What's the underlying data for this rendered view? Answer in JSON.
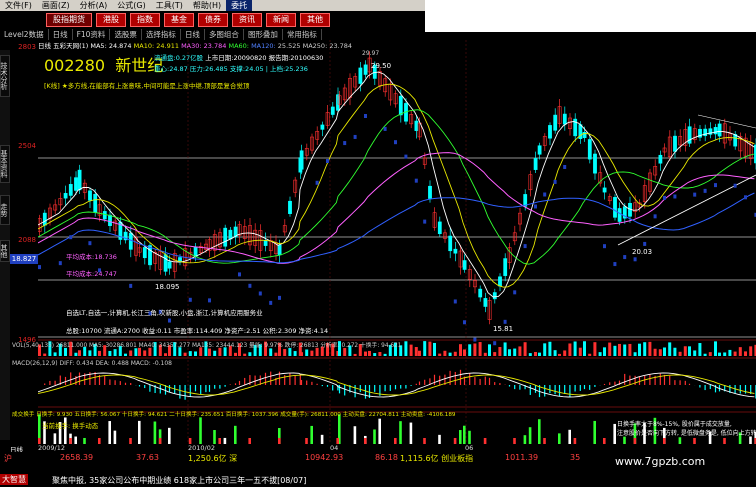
{
  "menu": {
    "items": [
      "文件(F)",
      "画面(Z)",
      "分析(A)",
      "公式(G)",
      "工具(T)",
      "帮助(H)",
      "委托"
    ]
  },
  "tabs": [
    "股指期货",
    "港股",
    "指数",
    "基金",
    "债券",
    "资讯",
    "新闻",
    "其他"
  ],
  "toolbar": {
    "items": [
      "Level2数据",
      "日线",
      "F10资料",
      "选股票",
      "选择指标",
      "日线",
      "多图组合",
      "图形叠加",
      "常用指标"
    ]
  },
  "main_header": {
    "period": "日线",
    "name": "五彩天网(1)",
    "ma5": "MA5: 24.874",
    "ma10": "MA10: 24.911",
    "ma30": "MA30: 23.784",
    "ma60": "MA60:",
    "ma120": "MA120:",
    "rest": "25.525  MA250: 23.784"
  },
  "stock": {
    "code": "002280",
    "name": "新世纪",
    "circulating": "流通盘:0.27亿股",
    "listing_date": "上市日期:20090820",
    "report_date": "报告期:20100630",
    "line2": "重心:24.87 压力:26.485 支撑:24.05 | 上档:25.236",
    "kline_msg": "[K线] ★多方线,在能部有上涨意味,中间可能是上涨中继,顶部是复合觉顶"
  },
  "price_axis": {
    "ticks": [
      "2803",
      "2504",
      "2088",
      "1496"
    ],
    "current_price": "18.827"
  },
  "annotations": {
    "high": "29.50",
    "high2": "29.97",
    "low1": "18.095",
    "low2": "15.81",
    "low3": "20.03",
    "cost1": "平均成本:18.736",
    "cost2": "平均成本:24.747",
    "concepts": "自选LT,自选一,计算机,长江三角,次新股,小盘,浙江,计算机应用服务业",
    "capital": "总股:10700 流通A:2700 收益:0.11 市盈率:114.409 净资产:2.51 公积:2.309 净资:4.14"
  },
  "volume_header": "VOL(5,40,135) 26811.000  MA5: 30286.801  MA40: 34357.277  MA135: 23444.123  量能: 9.97%  跌停: 26813  分析率: 0.272  十换手: 94.621",
  "macd_header": "MACD(26,12,9)  DIFF: 0.434  DEA: 0.488  MACD: -0.108",
  "turnover_header": "成交换手  日换手: 9.930  五日换手: 56.067  十日换手: 94.621  二十日换手: 235.651  百日换手: 1037.396  成交量(手): 26811.000  主动买盘: 22704.811  主动卖盘: -4106.189",
  "turnover_side": "当前换手: 换手动态",
  "right_notes": [
    "日换手率大于8%-15%, 股价属于成交放量,",
    "注意股价是否向下方转, 是低微盘务是, 低位向上方转"
  ],
  "dates": [
    "日线",
    "2009/12",
    "2010/02",
    "04",
    "06"
  ],
  "status": {
    "label1": "沪",
    "index1": "2658.39",
    "change1": "37.63",
    "amount1": "1,250.6亿 深",
    "index2": "10942.93",
    "change2": "86.18",
    "amount2": "1,115.6亿 创业板指",
    "index3": "1011.39",
    "change3": "35",
    "ticker": "聚焦中报, 35家公司公布中期业绩 618家上市公司三年一五不拔[08/07]",
    "brand": "大智慧"
  },
  "watermark": "www.7gpzb.com",
  "colors": {
    "up": "#ff3030",
    "down": "#00ffff",
    "bg": "#000000",
    "accent": "#e8e800"
  }
}
